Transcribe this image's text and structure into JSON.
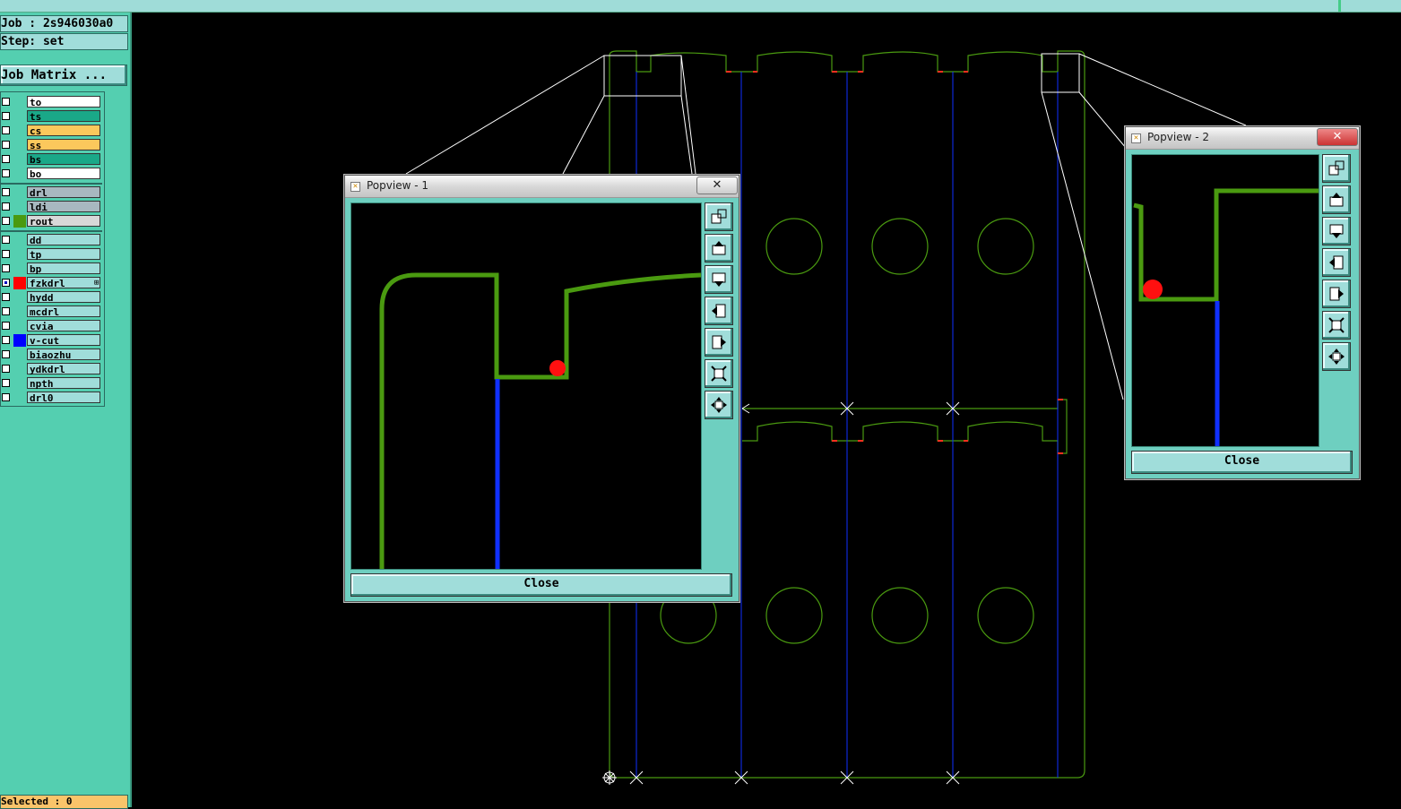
{
  "job_label": "Job : 2s946030a0",
  "step_label": "Step: set",
  "job_matrix_button": "Job Matrix ...",
  "selected_label": "Selected : 0",
  "layers": [
    {
      "name": "to",
      "color": "#ffffff",
      "swatch": ""
    },
    {
      "name": "ts",
      "color": "#1aa888",
      "swatch": ""
    },
    {
      "name": "cs",
      "color": "#fbc85c",
      "swatch": ""
    },
    {
      "name": "ss",
      "color": "#fbc85c",
      "swatch": ""
    },
    {
      "name": "bs",
      "color": "#1aa888",
      "swatch": ""
    },
    {
      "name": "bo",
      "color": "#ffffff",
      "swatch": ""
    },
    {
      "name": "drl",
      "color": "#a8b8c0",
      "swatch": ""
    },
    {
      "name": "ldi",
      "color": "#a8b8c0",
      "swatch": ""
    },
    {
      "name": "rout",
      "color": "#d8d8d8",
      "swatch": "#4a9a10"
    },
    {
      "name": "dd",
      "color": "#a0ddda",
      "swatch": ""
    },
    {
      "name": "tp",
      "color": "#a0ddda",
      "swatch": ""
    },
    {
      "name": "bp",
      "color": "#a0ddda",
      "swatch": ""
    },
    {
      "name": "fzkdrl",
      "color": "#a0ddda",
      "swatch": "#ff0000",
      "marker": "⊞"
    },
    {
      "name": "hydd",
      "color": "#a0ddda",
      "swatch": ""
    },
    {
      "name": "mcdrl",
      "color": "#a0ddda",
      "swatch": ""
    },
    {
      "name": "cvia",
      "color": "#a0ddda",
      "swatch": ""
    },
    {
      "name": "v-cut",
      "color": "#a0ddda",
      "swatch": "#0000ff"
    },
    {
      "name": "biaozhu",
      "color": "#a0ddda",
      "swatch": ""
    },
    {
      "name": "ydkdrl",
      "color": "#a0ddda",
      "swatch": ""
    },
    {
      "name": "npth",
      "color": "#a0ddda",
      "swatch": ""
    },
    {
      "name": "drl0",
      "color": "#a0ddda",
      "swatch": ""
    }
  ],
  "popview1": {
    "title": "Popview - 1",
    "close_label": "Close",
    "x_label": "✕"
  },
  "popview2": {
    "title": "Popview - 2",
    "close_label": "Close",
    "x_label": "✕"
  },
  "popview_tools": [
    "zoom-window-icon",
    "pan-up-icon",
    "pan-down-icon",
    "pan-left-icon",
    "pan-right-icon",
    "zoom-in-icon",
    "zoom-out-icon"
  ],
  "colors": {
    "rout": "#4a9a10",
    "vcut": "#1030ff",
    "pad": "#ff2020",
    "panel_bg": "#54cfb0",
    "button_bg": "#a0ddda"
  }
}
